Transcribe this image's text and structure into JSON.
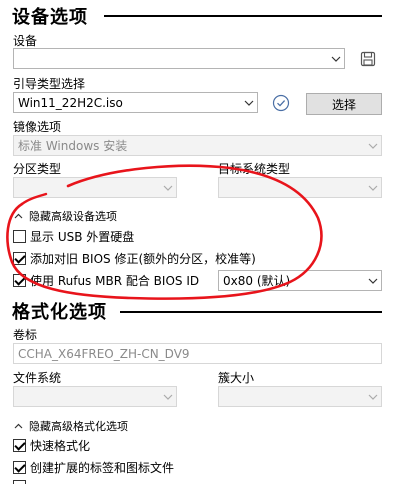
{
  "drive_properties": {
    "title": "设备选项",
    "device": {
      "label": "设备",
      "value": ""
    },
    "boot_selection": {
      "label": "引导类型选择",
      "value": "Win11_22H2C.iso",
      "select_button": "选择"
    },
    "image_option": {
      "label": "镜像选项",
      "value": "标准 Windows 安装"
    },
    "partition_scheme": {
      "label": "分区类型",
      "value": ""
    },
    "target_system": {
      "label": "目标系统类型",
      "value": ""
    },
    "advanced": {
      "toggle_label": "隐藏高级设备选项",
      "list_usb": {
        "label": "显示 USB 外置硬盘",
        "checked": false
      },
      "bios_fixes": {
        "label": "添加对旧 BIOS 修正(额外的分区，校准等)",
        "checked": true
      },
      "rufus_mbr": {
        "label": "使用 Rufus MBR 配合 BIOS ID",
        "checked": true
      },
      "bios_id": {
        "value": "0x80 (默认)"
      }
    }
  },
  "format_options": {
    "title": "格式化选项",
    "volume_label": {
      "label": "卷标",
      "value": "CCHA_X64FREO_ZH-CN_DV9"
    },
    "file_system": {
      "label": "文件系统",
      "value": ""
    },
    "cluster_size": {
      "label": "簇大小",
      "value": ""
    },
    "advanced": {
      "toggle_label": "隐藏高级格式化选项",
      "quick_format": {
        "label": "快速格式化",
        "checked": true
      },
      "extended_label": {
        "label": "创建扩展的标签和图标文件",
        "checked": true
      }
    }
  },
  "colors": {
    "annotation": "#e8141b",
    "rule": "#000000"
  },
  "icons": {
    "save": "floppy-disk-icon",
    "verify": "checkmark-circle-icon",
    "dropdown": "chevron-down-icon",
    "collapse": "chevron-up-icon"
  }
}
